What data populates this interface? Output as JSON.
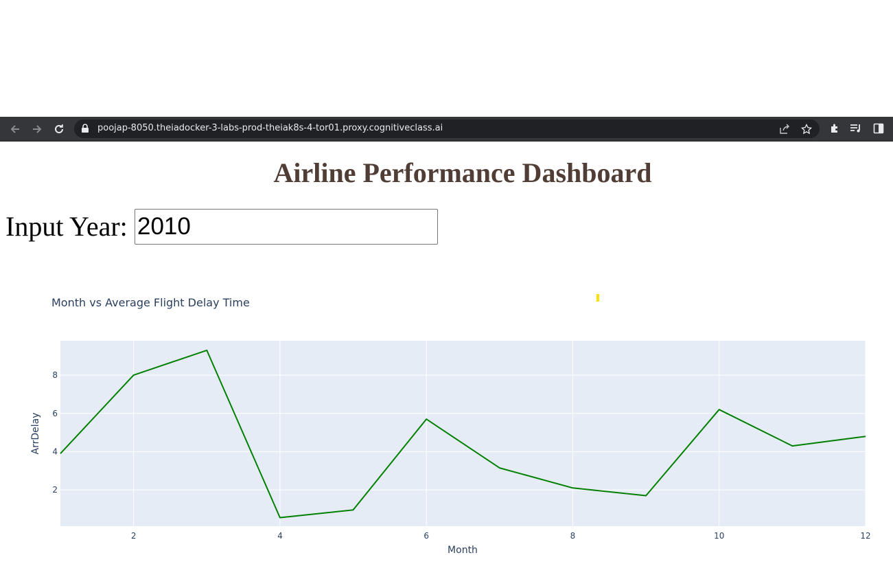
{
  "browser": {
    "url": "poojap-8050.theiadocker-3-labs-prod-theiak8s-4-tor01.proxy.cognitiveclass.ai",
    "icons": [
      "back-arrow-icon",
      "forward-arrow-icon",
      "reload-icon",
      "lock-icon",
      "share-icon",
      "bookmark-star-icon",
      "extensions-icon",
      "reading-list-icon",
      "side-panel-icon"
    ]
  },
  "page": {
    "title": "Airline Performance Dashboard",
    "input_label": "Input Year:",
    "input_value": "2010"
  },
  "colors": {
    "title": "#503d36",
    "line": "#008000",
    "plot_bg": "#e5ecf6",
    "toolbar": "#35363a"
  },
  "chart_data": {
    "type": "line",
    "title": "Month vs Average Flight Delay Time",
    "xlabel": "Month",
    "ylabel": "ArrDelay",
    "x": [
      1,
      2,
      3,
      4,
      5,
      6,
      7,
      8,
      9,
      10,
      11,
      12
    ],
    "series": [
      {
        "values": [
          3.9,
          8.0,
          9.3,
          0.55,
          0.95,
          5.7,
          3.15,
          2.1,
          1.7,
          6.2,
          4.3,
          4.8
        ]
      }
    ],
    "xlim": [
      1,
      12
    ],
    "ylim": [
      0.1,
      9.8
    ],
    "xticks": [
      2,
      4,
      6,
      8,
      10,
      12
    ],
    "yticks": [
      2,
      4,
      6,
      8
    ],
    "grid": true,
    "legend": "none"
  }
}
